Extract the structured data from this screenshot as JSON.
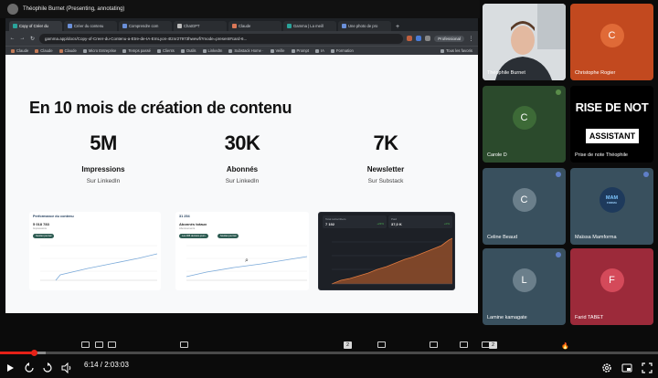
{
  "presenter": {
    "title": "Théophile Burnet (Presenting, annotating)"
  },
  "browser": {
    "tabs": [
      {
        "label": "Copy of Créer du",
        "active": true
      },
      {
        "label": "Créer du contenu",
        "active": false
      },
      {
        "label": "Comprendre com",
        "active": false
      },
      {
        "label": "ChatGPT",
        "active": false
      },
      {
        "label": "Claude",
        "active": false
      },
      {
        "label": "Gamma | La meill",
        "active": false
      },
      {
        "label": "Une photo de pro",
        "active": false
      }
    ],
    "url": "gamma.app/docs/Copy-of-Creer-du-Contenu-a-Etre-de-IA-EmLyon-4tznr27973hwewfi?mode=present#card-6...",
    "profile_label": "Professional",
    "bookmarks": [
      "Claude",
      "Claude",
      "Claude",
      "Micro Entreprise",
      "Temps passé",
      "Clients",
      "Outils",
      "LinkedIn",
      "Substack Home ·",
      "Veille",
      "Prompt",
      "IA",
      "Formation"
    ],
    "bookmarks_right": "Tous les favoris"
  },
  "slide": {
    "title": "En 10 mois de création de contenu",
    "stats": [
      {
        "value": "5M",
        "label": "Impressions",
        "sub": "Sur LinkedIn"
      },
      {
        "value": "30K",
        "label": "Abonnés",
        "sub": "Sur LinkedIn"
      },
      {
        "value": "7K",
        "label": "Newsletter",
        "sub": "Sur Substack"
      }
    ],
    "cards": {
      "impressions": {
        "title": "Performance du contenu",
        "figure": "5 018 783",
        "caption": "Impressions",
        "pill": "Soutien journal"
      },
      "followers": {
        "title": "31 254",
        "figure": "Abonnés totaux",
        "caption": "Abonnements",
        "pills": [
          "Les 365 derniers jours",
          "Soutien journal"
        ]
      },
      "newsletter": {
        "kpis": [
          {
            "title": "Total subscribers",
            "value": "7 192",
            "badge": "+23%"
          },
          {
            "title": "Paid",
            "value": "37,0 K",
            "badge": "+0%"
          }
        ]
      }
    }
  },
  "participants": [
    {
      "name": "Théophile Burnet",
      "kind": "video"
    },
    {
      "name": "Christophe Rogier",
      "initial": "C",
      "bg": "#c2491f",
      "avatar_bg": "#e06a37"
    },
    {
      "name": "Carole D",
      "initial": "C",
      "bg": "#2b4a2c",
      "avatar_bg": "#3d6a37"
    },
    {
      "name": "Prise de note Théophile",
      "kind": "note",
      "sign_text": "RISE DE NOT",
      "box_text": "ASSISTANT"
    },
    {
      "name": "Celine Beaud",
      "initial": "C",
      "bg": "#39505e",
      "avatar_bg": "#6b7f8b"
    },
    {
      "name": "Maïssa Mamforma",
      "kind": "logo",
      "logo_text": "MAM",
      "logo_sub": "FORMA"
    },
    {
      "name": "Lamine kamagate",
      "initial": "L",
      "bg": "#39505e",
      "avatar_bg": "#6b7f8b"
    },
    {
      "name": "Farid TABET",
      "initial": "F",
      "bg": "#9c2a3a",
      "avatar_bg": "#d44a5a"
    }
  ],
  "player": {
    "time_current": "6:14",
    "time_total": "2:03:03",
    "progress": 0.0507,
    "loaded": 0.07,
    "comment_counts": [
      "2",
      "2"
    ]
  },
  "colors": {
    "progress": "#e62117",
    "slide_bg": "#f8f9fa",
    "accent_green": "#2d5b52"
  }
}
